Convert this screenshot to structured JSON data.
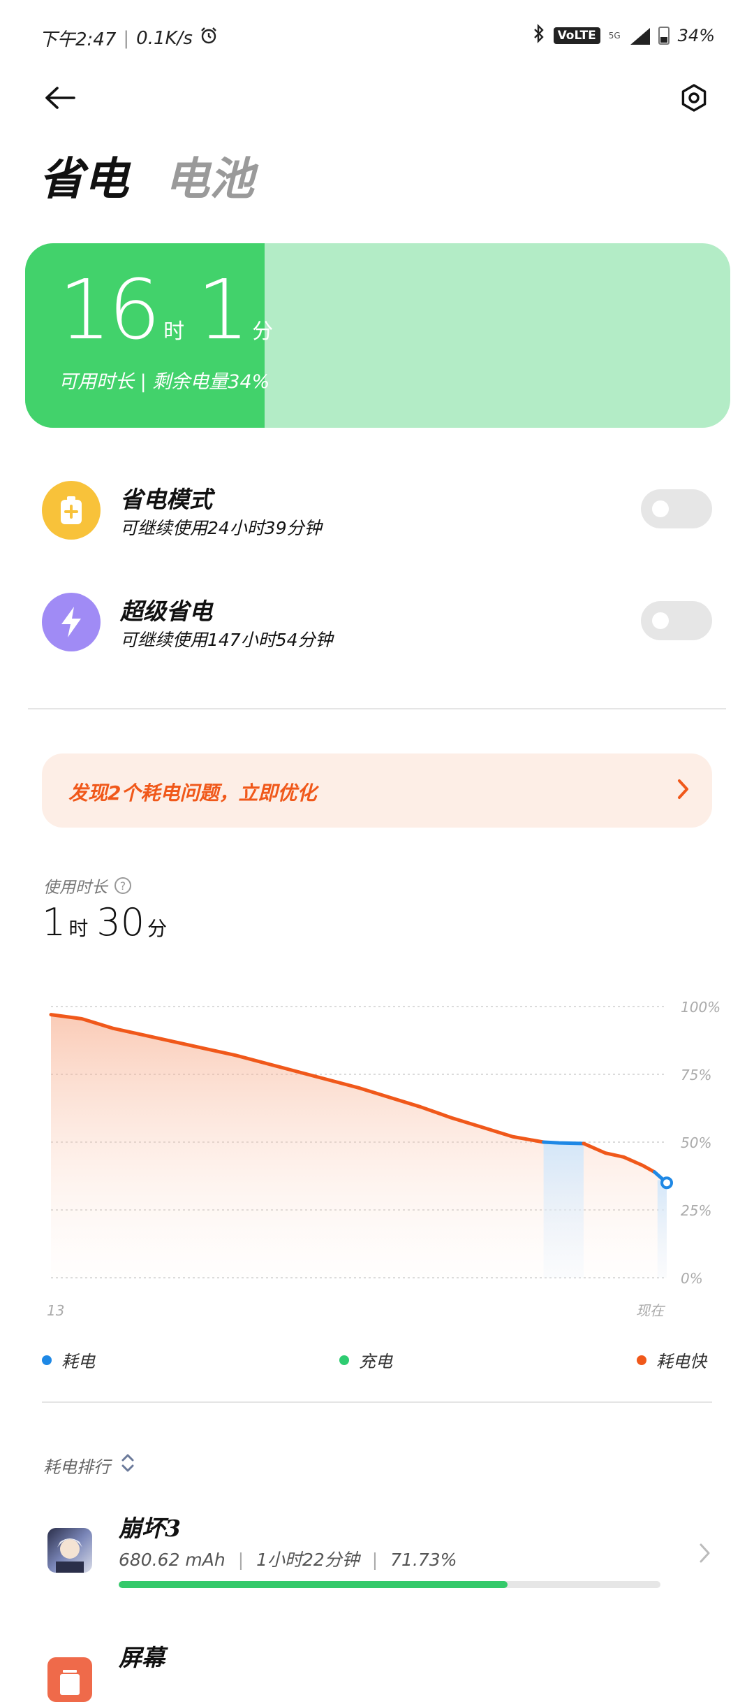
{
  "status_bar": {
    "time": "下午2:47",
    "net_speed": "0.1K/s",
    "volte": "VoLTE",
    "network": "5G",
    "battery": "34%"
  },
  "header": {
    "tab_power_saving": "省电",
    "tab_battery": "电池"
  },
  "battery_card": {
    "hours": "16",
    "hours_unit": "时",
    "minutes": "1",
    "minutes_unit": "分",
    "subtitle": "可用时长 | 剩余电量34%",
    "level": 0.34,
    "fill_color": "#42d26b",
    "bg_color": "#b3ecc6"
  },
  "modes": [
    {
      "title": "省电模式",
      "subtitle": "可继续使用24小时39分钟",
      "icon": "battery-plus-icon",
      "color": "#f8c23a",
      "enabled": false
    },
    {
      "title": "超级省电",
      "subtitle": "可继续使用147小时54分钟",
      "icon": "lightning-icon",
      "color": "#a08bf5",
      "enabled": false
    }
  ],
  "alert": {
    "text": "发现2个耗电问题，立即优化",
    "color": "#f0581a"
  },
  "usage": {
    "label": "使用时长",
    "hours": "1",
    "hours_unit": "时",
    "minutes": "30",
    "minutes_unit": "分"
  },
  "chart_data": {
    "type": "area",
    "x_labels": [
      "13",
      "现在"
    ],
    "y_ticks": [
      "100%",
      "75%",
      "50%",
      "25%",
      "0%"
    ],
    "ylim": [
      0,
      100
    ],
    "grid": true,
    "points": [
      [
        0,
        97
      ],
      [
        0.05,
        95.5
      ],
      [
        0.1,
        92
      ],
      [
        0.15,
        89.5
      ],
      [
        0.2,
        87
      ],
      [
        0.25,
        84.5
      ],
      [
        0.3,
        82
      ],
      [
        0.35,
        79
      ],
      [
        0.4,
        76
      ],
      [
        0.45,
        73
      ],
      [
        0.5,
        70
      ],
      [
        0.55,
        66.5
      ],
      [
        0.6,
        63
      ],
      [
        0.65,
        59
      ],
      [
        0.7,
        55.5
      ],
      [
        0.75,
        52
      ],
      [
        0.8,
        50
      ],
      [
        0.825,
        49.7
      ],
      [
        0.865,
        49.5
      ],
      [
        0.9,
        46
      ],
      [
        0.93,
        44.5
      ],
      [
        0.96,
        41.5
      ],
      [
        0.98,
        39
      ],
      [
        1.0,
        35
      ]
    ],
    "charging_segment": [
      0.8,
      0.865
    ],
    "colors": {
      "drain": "#1e88e5",
      "charge": "#2ecc71",
      "fast_drain": "#f0581a"
    }
  },
  "legend": [
    {
      "label": "耗电",
      "color": "#1e88e5"
    },
    {
      "label": "充电",
      "color": "#2ecc71"
    },
    {
      "label": "耗电快",
      "color": "#f0581a"
    }
  ],
  "ranking": {
    "label": "耗电排行",
    "apps": [
      {
        "name": "崩坏3",
        "mah": "680.62 mAh",
        "duration": "1小时22分钟",
        "percent": "71.73%",
        "share": 0.7173,
        "icon": "app-icon-honkai3"
      },
      {
        "name": "屏幕",
        "mah": "",
        "duration": "",
        "percent": "",
        "share": 0,
        "icon": "screen-icon"
      }
    ]
  }
}
